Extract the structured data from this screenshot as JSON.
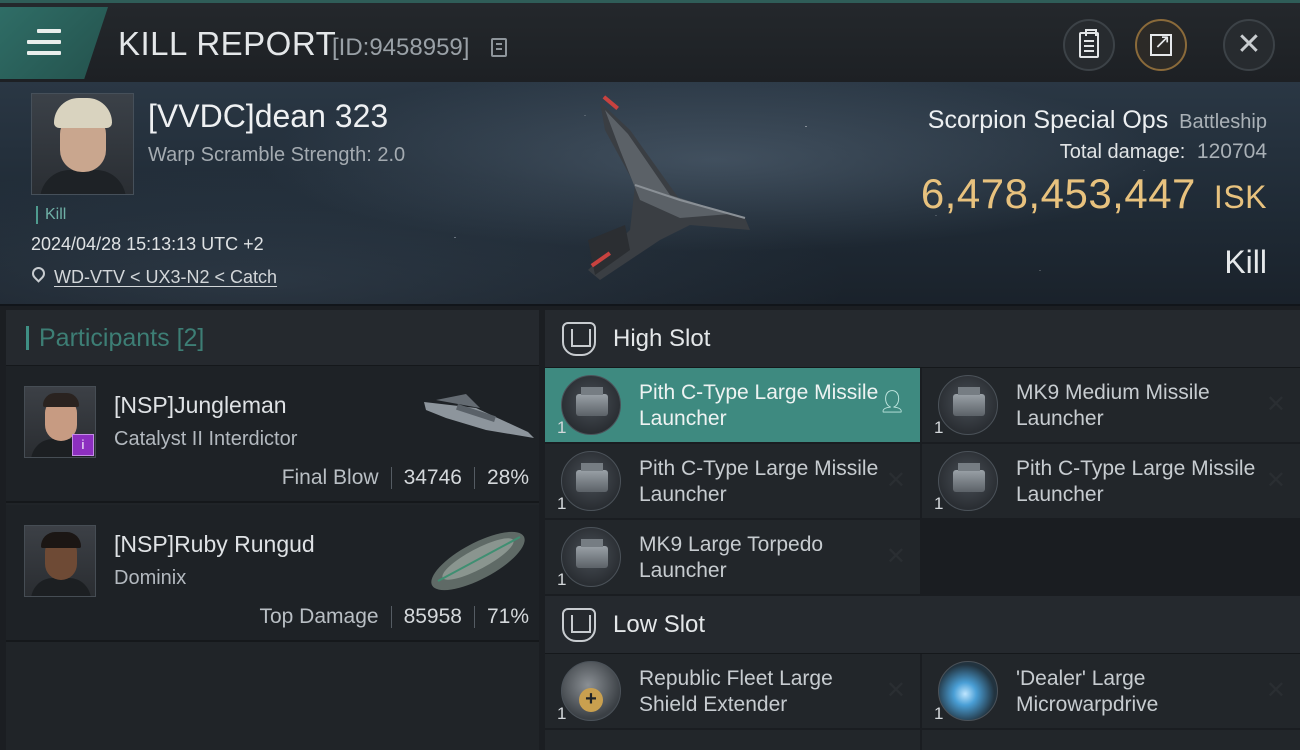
{
  "header": {
    "title": "KILL REPORT",
    "report_id": "[ID:9458959]"
  },
  "victim": {
    "name": "[VVDC]dean 323",
    "warp_scramble": "Warp Scramble Strength: 2.0",
    "kill_tag": "Kill",
    "datetime": "2024/04/28 15:13:13 UTC +2",
    "location": "WD-VTV < UX3-N2 < Catch",
    "ship_name": "Scorpion Special Ops",
    "ship_class": "Battleship",
    "total_damage_label": "Total damage:",
    "total_damage": "120704",
    "isk_value": "6,478,453,447",
    "isk_unit": "ISK",
    "result": "Kill"
  },
  "participants": {
    "label": "Participants",
    "count": "[2]",
    "rows": [
      {
        "name": "[NSP]Jungleman",
        "ship": "Catalyst II Interdictor",
        "role": "Final Blow",
        "damage": "34746",
        "percent": "28%"
      },
      {
        "name": "[NSP]Ruby Rungud",
        "ship": "Dominix",
        "role": "Top Damage",
        "damage": "85958",
        "percent": "71%"
      }
    ]
  },
  "high_slot": {
    "label": "High Slot",
    "modules": [
      {
        "qty": "1",
        "name": "Pith C-Type Large Missile Launcher"
      },
      {
        "qty": "1",
        "name": "MK9 Medium Missile Launcher"
      },
      {
        "qty": "1",
        "name": "Pith C-Type Large Missile Launcher"
      },
      {
        "qty": "1",
        "name": "Pith C-Type Large Missile Launcher"
      },
      {
        "qty": "1",
        "name": "MK9 Large Torpedo Launcher"
      }
    ]
  },
  "low_slot": {
    "label": "Low Slot",
    "modules": [
      {
        "qty": "1",
        "name": "Republic Fleet Large Shield Extender"
      },
      {
        "qty": "1",
        "name": "'Dealer' Large Microwarpdrive"
      }
    ]
  },
  "icons": {
    "menu": "menu-icon",
    "copy": "copy-icon",
    "clipboard": "clipboard-icon",
    "share": "share-icon",
    "close": "close-icon",
    "location": "location-pin-icon",
    "slot": "slot-shield-icon",
    "person": "person-icon",
    "destroyed": "x-icon"
  },
  "colors": {
    "accent": "#3e8a80",
    "isk": "#e8c27e",
    "corp_badge": "#8d2fc0"
  }
}
